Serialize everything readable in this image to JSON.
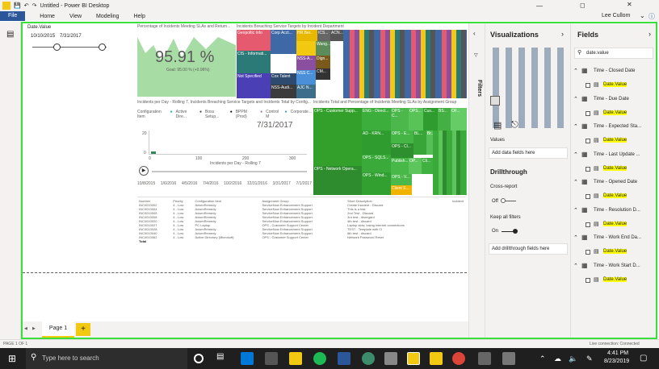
{
  "window": {
    "title": "Untitled - Power BI Desktop",
    "user": "Lee Cullom"
  },
  "menu": [
    "File",
    "Home",
    "View",
    "Modeling",
    "Help"
  ],
  "slicer": {
    "title": "Date.Value",
    "start": "10/10/2015",
    "end": "7/31/2017"
  },
  "kpi": {
    "title": "Percentage of Incidents Meeting SLAs and Return...",
    "value": "95.91 %",
    "goal": "Goal: 95.00 % (+0.96%)"
  },
  "treemap1": {
    "title": "Incidents Breaching Service Targets by Incident Department",
    "tiles": [
      "Geopoltic Info",
      "Corp Acct...",
      "CIS - Informati...",
      "Not Specified",
      "Cox Talent",
      "NSS-Audi...",
      "HR Ber..",
      "ICS...",
      "ACN...",
      "Wang...",
      "Dign...",
      "NSS-A...",
      "CM...",
      "NSS C...",
      "AJC N..."
    ]
  },
  "line": {
    "title": "Incidents per Day - Rolling 7, Incidents Breaching Service Targets and Incidents Total by Config...",
    "legend_label": "Configuration Item",
    "legend": [
      "Active Dire...",
      "Boss Setup...",
      "BPPM (Prod)",
      "Control M",
      "Corporate..."
    ],
    "date_label": "7/31/2017",
    "x_label": "Incidents per Day - Rolling 7",
    "y_label": "Incidents Breaching",
    "xticks": [
      "0",
      "100",
      "200",
      "300"
    ],
    "yticks": [
      "20",
      "0"
    ],
    "play_dates": [
      "10/8/2015",
      "1/6/2016",
      "4/5/2016",
      "7/4/2016",
      "10/2/2016",
      "12/31/2016",
      "3/31/2017",
      "7/1/2017"
    ]
  },
  "treemap2": {
    "title": "Incidents Total and Percentage of Incidents Meeting SLAs by Assignment Group",
    "tiles": [
      "OPS - Customer Supp...",
      "ENG - Direct...",
      "OPS - C...",
      "OPS...",
      "Cus...",
      "BS...",
      "OF...",
      "AD - KRN...",
      "OPS - E...",
      "BL...",
      "Br...",
      "OPS - SQLS...",
      "OPS - Cl...",
      "Publish...",
      "OP...",
      "Cli...",
      "OPS - Network Opera...",
      "OPS - Wind...",
      "OPS - V...",
      "Client S..."
    ]
  },
  "table": {
    "columns": [
      "Number",
      "Priority",
      "Configuration Item",
      "Assignment Group",
      "Short Description",
      "Incident"
    ],
    "rows": [
      [
        "INC0010002",
        "4 - Low",
        "AxiomRemedy",
        "ServiceNow Enhancement Support",
        "Create Incident - Discard"
      ],
      [
        "INC0010004",
        "4 - Low",
        "AxiomRemedy",
        "ServiceNow Enhancement Support",
        "This is a test"
      ],
      [
        "INC0010005",
        "4 - Low",
        "AxiomRemedy",
        "ServiceNow Enhancement Support",
        "2nd Test - Discard"
      ],
      [
        "INC0010008",
        "4 - Low",
        "AxiomRemedy",
        "ServiceNow Enhancement Support",
        "3rd test - disregard"
      ],
      [
        "INC0010020",
        "4 - Low",
        "AxiomRemedy",
        "ServiceNow Enhancement Support",
        "4th test - discard"
      ],
      [
        "INC0010027",
        "4 - Low",
        "PC Laptop",
        "OPS - Customer Support Center",
        "Laptop slow, losing internet connections"
      ],
      [
        "INC0010028",
        "4 - Low",
        "AxiomRemedy",
        "ServiceNow Enhancement Support",
        "TEST - Template with CI"
      ],
      [
        "INC0010040",
        "4 - Low",
        "AxiomRemedy",
        "ServiceNow Enhancement Support",
        "6th test - discard"
      ],
      [
        "INC0010062",
        "4 - Low",
        "Active Directory (Microsoft)",
        "OPS - Customer Support Center",
        "Network Password Reset"
      ]
    ],
    "total": "Total"
  },
  "filters_label": "Filters",
  "viz": {
    "title": "Visualizations",
    "values": "Values",
    "add": "Add data fields here",
    "drill": "Drillthrough",
    "cross": "Cross-report",
    "cross_state": "Off",
    "keep": "Keep all filters",
    "keep_state": "On",
    "drill_add": "Add drillthrough fields here"
  },
  "fields": {
    "title": "Fields",
    "search": "date.value",
    "tables": [
      {
        "name": "Time - Closed Date",
        "field": "Date.Value"
      },
      {
        "name": "Time - Due Date",
        "field": "Date.Value"
      },
      {
        "name": "Time - Expected Sta...",
        "field": "Date.Value"
      },
      {
        "name": "Time - Last Update ...",
        "field": "Date.Value"
      },
      {
        "name": "Time - Opened Date",
        "field": "Date.Value"
      },
      {
        "name": "Time - Resolution D...",
        "field": "Date.Value"
      },
      {
        "name": "Time - Work End Da...",
        "field": "Date.Value"
      },
      {
        "name": "Time - Work Start D...",
        "field": "Date.Value"
      }
    ]
  },
  "pages": {
    "tab": "Page 1",
    "add": "+"
  },
  "status": {
    "left": "PAGE 1 OF 1",
    "right": "Live connection: Connected"
  },
  "taskbar": {
    "search": "Type here to search",
    "time": "4:41 PM",
    "date": "8/23/2019"
  }
}
